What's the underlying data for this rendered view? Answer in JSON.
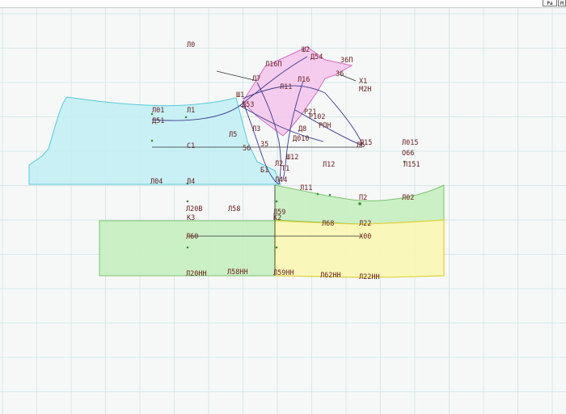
{
  "toolbar": {
    "button_1": "Pa",
    "button_2": "M"
  },
  "colors": {
    "canvas_background": "#f6f8f8",
    "grid": "#d7e7e9",
    "piece_cyan": "#bfeef5",
    "piece_pink": "#f5c4ec",
    "piece_green": "#c6eec0",
    "piece_yellow": "#fbf6b4",
    "label": "#6a2020"
  },
  "point_labels": {
    "p0": "Л0",
    "u2": "Ш2",
    "d54": "Д54",
    "p36p": "36П",
    "p16p": "Л16П",
    "p36": "36",
    "i1": "Х1",
    "m2n": "М2Н",
    "p7": "Л7",
    "p16": "Л16",
    "p11": "Л11",
    "u1": "Ш1",
    "d53": "Д53",
    "p01": "Л01",
    "a1": "Л1",
    "p21": "Р21",
    "d51": "Д51",
    "p102": "Р102",
    "rpn": "РПН",
    "p3": "Л3",
    "d8": "Д8",
    "p5": "Л5",
    "p010": "Д010",
    "p15": "Л15",
    "p015": "Л015",
    "p6": "Л6",
    "p35": "35",
    "c1": "С1",
    "p56": "56",
    "p066": "О66",
    "p12": "Л12",
    "p151": "Л151",
    "p112": "Ш12",
    "g1": "Б1",
    "g2": "Л2",
    "t1": "Т1",
    "p04": "Л04",
    "p4": "Л4",
    "p11b": "Л11",
    "p44": "Л44",
    "n2": "П2",
    "p02": "Л02",
    "p20b": "Л20В",
    "p58": "Л58",
    "p59": "Л59",
    "k3": "К3",
    "k2": "К2",
    "p68": "Л68",
    "p22": "Л22",
    "p60": "Л60",
    "x00": "Х00",
    "p20nn": "Л20НН",
    "p58nn": "Л58НН",
    "p59nn": "Л59НН",
    "p62nn": "Л62НН",
    "p22nn": "Л22НН"
  }
}
